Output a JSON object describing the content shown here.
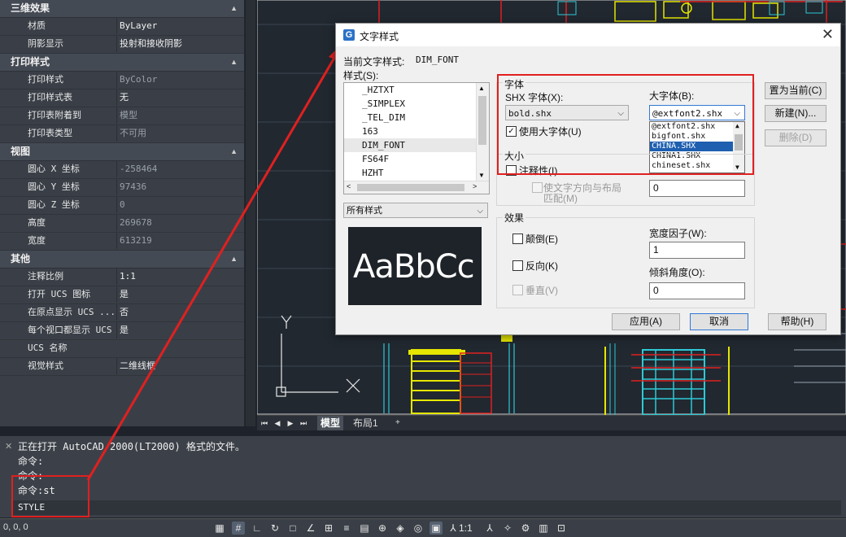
{
  "palette": {
    "sections": [
      {
        "title": "三维效果",
        "rows": [
          {
            "k": "材质",
            "v": "ByLayer",
            "dim": false
          },
          {
            "k": "阴影显示",
            "v": "投射和接收阴影",
            "dim": false
          }
        ]
      },
      {
        "title": "打印样式",
        "rows": [
          {
            "k": "打印样式",
            "v": "ByColor",
            "dim": true
          },
          {
            "k": "打印样式表",
            "v": "无",
            "dim": false
          },
          {
            "k": "打印表附着到",
            "v": "模型",
            "dim": true
          },
          {
            "k": "打印表类型",
            "v": "不可用",
            "dim": true
          }
        ]
      },
      {
        "title": "视图",
        "rows": [
          {
            "k": "圆心 X 坐标",
            "v": "-258464",
            "dim": true
          },
          {
            "k": "圆心 Y 坐标",
            "v": "97436",
            "dim": true
          },
          {
            "k": "圆心 Z 坐标",
            "v": "0",
            "dim": true
          },
          {
            "k": "高度",
            "v": "269678",
            "dim": true
          },
          {
            "k": "宽度",
            "v": "613219",
            "dim": true
          }
        ]
      },
      {
        "title": "其他",
        "rows": [
          {
            "k": "注释比例",
            "v": "1:1",
            "dim": false
          },
          {
            "k": "打开 UCS 图标",
            "v": "是",
            "dim": false
          },
          {
            "k": "在原点显示 UCS ...",
            "v": "否",
            "dim": false
          },
          {
            "k": "每个视口都显示 UCS",
            "v": "是",
            "dim": false
          },
          {
            "k": "UCS 名称",
            "v": "",
            "dim": false
          },
          {
            "k": "视觉样式",
            "v": "二维线框",
            "dim": false
          }
        ]
      }
    ]
  },
  "tabs": {
    "model": "模型",
    "layout": "布局1",
    "add": "+"
  },
  "ucs": {
    "x": "X",
    "y": "Y"
  },
  "command": {
    "lines": [
      "正在打开 AutoCAD 2000(LT2000) 格式的文件。",
      "命令:",
      "命令:",
      "命令:st"
    ],
    "input": "STYLE",
    "coords": "0, 0, 0"
  },
  "dialog": {
    "title": "文字样式",
    "current_style_label": "当前文字样式:",
    "current_style_value": "DIM_FONT",
    "styles_label": "样式(S):",
    "styles": [
      "_HZTXT",
      "_SIMPLEX",
      "_TEL_DIM",
      "163",
      "DIM_FONT",
      "FS64F",
      "HZHT"
    ],
    "styles_selected": 4,
    "filter": "所有样式",
    "preview_text": "AaBbCc",
    "font_group": "字体",
    "shx_label": "SHX 字体(X):",
    "shx_value": "bold.shx",
    "use_bigfont": "使用大字体(U)",
    "bigfont_label": "大字体(B):",
    "bigfont_value": "@extfont2.shx",
    "bigfont_options": [
      "@extfont2.shx",
      "bigfont.shx",
      "CHINA.SHX",
      "CHINA1.SHX",
      "chineset.shx"
    ],
    "bigfont_selected": 2,
    "size_group": "大小",
    "annotative": "注释性(I)",
    "match_orient": "使文字方向与布局",
    "match_orient2": "匹配(M)",
    "height_value": "0",
    "effects_group": "效果",
    "upside_down": "颠倒(E)",
    "backwards": "反向(K)",
    "vertical": "垂直(V)",
    "width_label": "宽度因子(W):",
    "width_value": "1",
    "oblique_label": "倾斜角度(O):",
    "oblique_value": "0",
    "set_current": "置为当前(C)",
    "new": "新建(N)...",
    "delete": "删除(D)",
    "apply": "应用(A)",
    "cancel": "取消",
    "help": "帮助(H)"
  }
}
